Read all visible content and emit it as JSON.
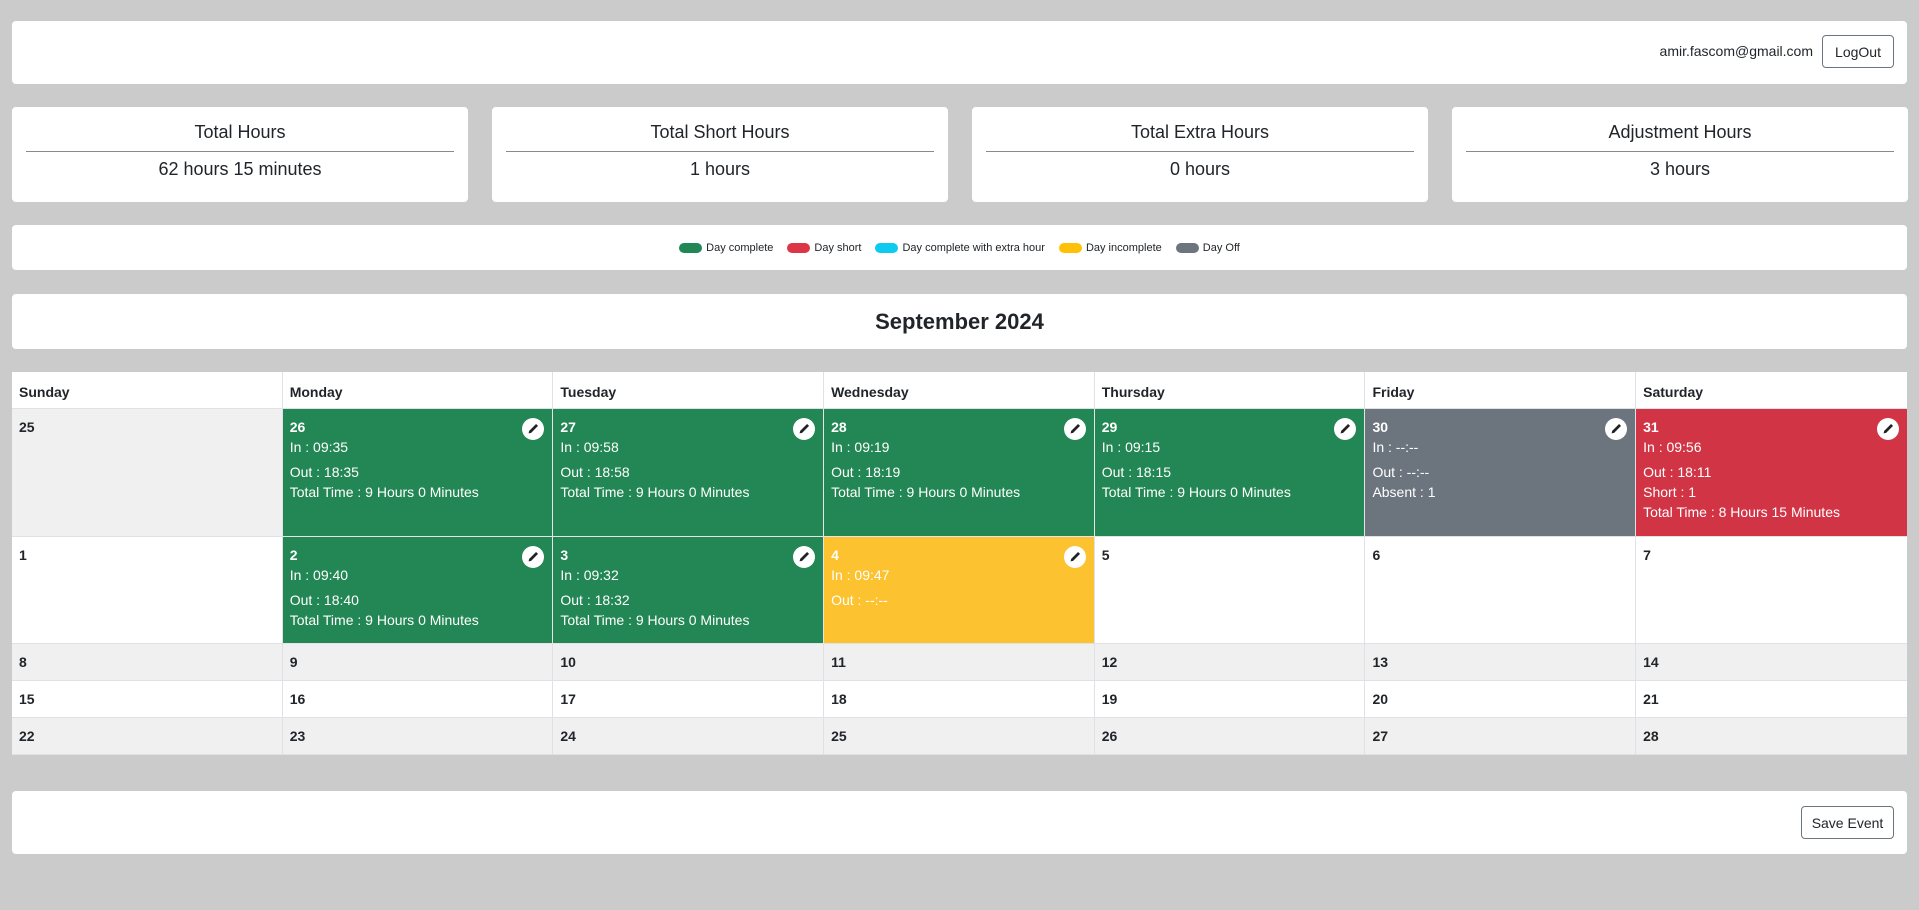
{
  "header": {
    "user_email": "amir.fascom@gmail.com",
    "logout_label": "LogOut"
  },
  "stats": [
    {
      "title": "Total Hours",
      "value": "62 hours 15 minutes"
    },
    {
      "title": "Total Short Hours",
      "value": "1 hours"
    },
    {
      "title": "Total Extra Hours",
      "value": "0 hours"
    },
    {
      "title": "Adjustment Hours",
      "value": "3 hours"
    }
  ],
  "legend": [
    {
      "label": "Day complete",
      "color": "#228754"
    },
    {
      "label": "Day short",
      "color": "#dc3545"
    },
    {
      "label": "Day complete with extra hour",
      "color": "#0dcaf0"
    },
    {
      "label": "Day incomplete",
      "color": "#ffc107"
    },
    {
      "label": "Day Off",
      "color": "#6c757d"
    }
  ],
  "calendar": {
    "month_title": "September 2024",
    "day_names": [
      "Sunday",
      "Monday",
      "Tuesday",
      "Wednesday",
      "Thursday",
      "Friday",
      "Saturday"
    ],
    "week1": [
      {
        "date": "25"
      },
      {
        "date": "26",
        "l1": "In : 09:35",
        "l2": "Out : 18:35",
        "l3": "Total Time : 9 Hours 0 Minutes"
      },
      {
        "date": "27",
        "l1": "In : 09:58",
        "l2": "Out : 18:58",
        "l3": "Total Time : 9 Hours 0 Minutes"
      },
      {
        "date": "28",
        "l1": "In : 09:19",
        "l2": "Out : 18:19",
        "l3": "Total Time : 9 Hours 0 Minutes"
      },
      {
        "date": "29",
        "l1": "In : 09:15",
        "l2": "Out : 18:15",
        "l3": "Total Time : 9 Hours 0 Minutes"
      },
      {
        "date": "30",
        "l1": "In : --:--",
        "l2": "Out : --:--",
        "l3": "Absent : 1"
      },
      {
        "date": "31",
        "l1": "In : 09:56",
        "l2": "Out : 18:11",
        "l3": "Short : 1",
        "l4": "Total Time : 8 Hours 15 Minutes"
      }
    ],
    "week2": [
      {
        "date": "1"
      },
      {
        "date": "2",
        "l1": "In : 09:40",
        "l2": "Out : 18:40",
        "l3": "Total Time : 9 Hours 0 Minutes"
      },
      {
        "date": "3",
        "l1": "In : 09:32",
        "l2": "Out : 18:32",
        "l3": "Total Time : 9 Hours 0 Minutes"
      },
      {
        "date": "4",
        "l1": "In : 09:47",
        "l2": "Out : --:--"
      },
      {
        "date": "5"
      },
      {
        "date": "6"
      },
      {
        "date": "7"
      }
    ],
    "week3": [
      "8",
      "9",
      "10",
      "11",
      "12",
      "13",
      "14"
    ],
    "week4": [
      "15",
      "16",
      "17",
      "18",
      "19",
      "20",
      "21"
    ],
    "week5": [
      "22",
      "23",
      "24",
      "25",
      "26",
      "27",
      "28"
    ]
  },
  "footer": {
    "save_label": "Save Event"
  },
  "icons": {
    "edit": "pencil-icon"
  }
}
